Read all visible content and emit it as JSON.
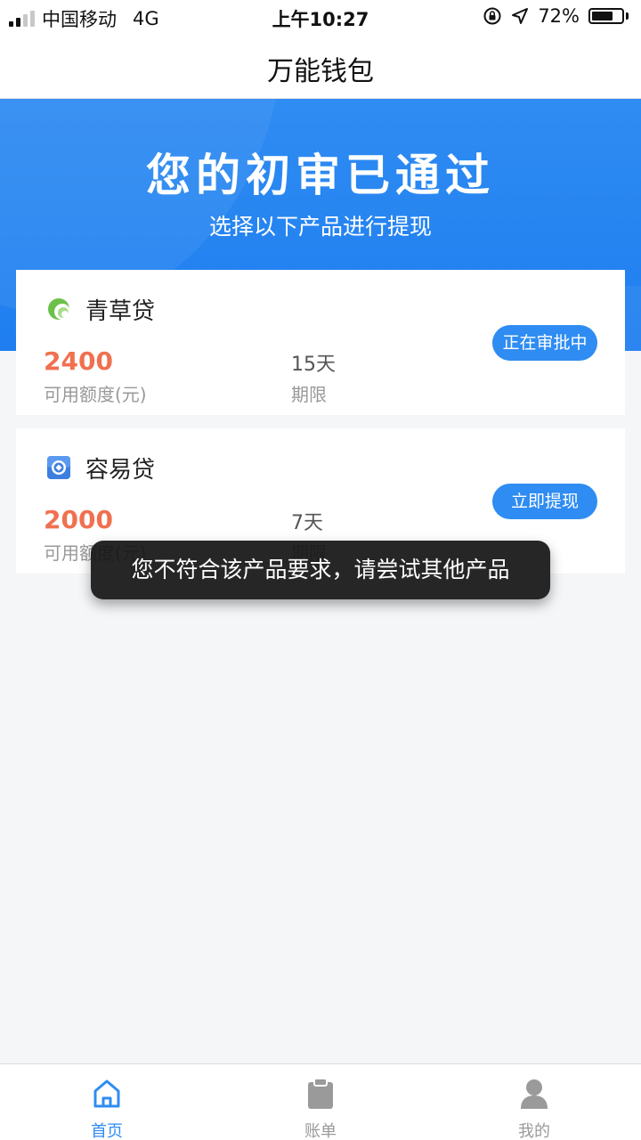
{
  "status_bar": {
    "carrier": "中国移动",
    "network": "4G",
    "time": "上午10:27",
    "battery": "72%",
    "battery_level": 0.72
  },
  "nav": {
    "title": "万能钱包"
  },
  "banner": {
    "title": "您的初审已通过",
    "subtitle": "选择以下产品进行提现"
  },
  "products": [
    {
      "name": "青草贷",
      "icon": "leaf-logo-icon",
      "amount": "2400",
      "amount_label": "可用额度(元)",
      "term": "15天",
      "term_label": "期限",
      "button": "正在审批中"
    },
    {
      "name": "容易贷",
      "icon": "coin-logo-icon",
      "amount": "2000",
      "amount_label": "可用额度(元)",
      "term": "7天",
      "term_label": "期限",
      "button": "立即提现"
    }
  ],
  "toast": {
    "message": "您不符合该产品要求，请尝试其他产品"
  },
  "tab_bar": {
    "items": [
      {
        "label": "首页",
        "icon": "home-icon",
        "active": true
      },
      {
        "label": "账单",
        "icon": "clipboard-icon",
        "active": false
      },
      {
        "label": "我的",
        "icon": "user-icon",
        "active": false
      }
    ]
  },
  "colors": {
    "primary": "#2f8cf2",
    "amount": "#f0704f",
    "toast_bg": "#141414"
  }
}
